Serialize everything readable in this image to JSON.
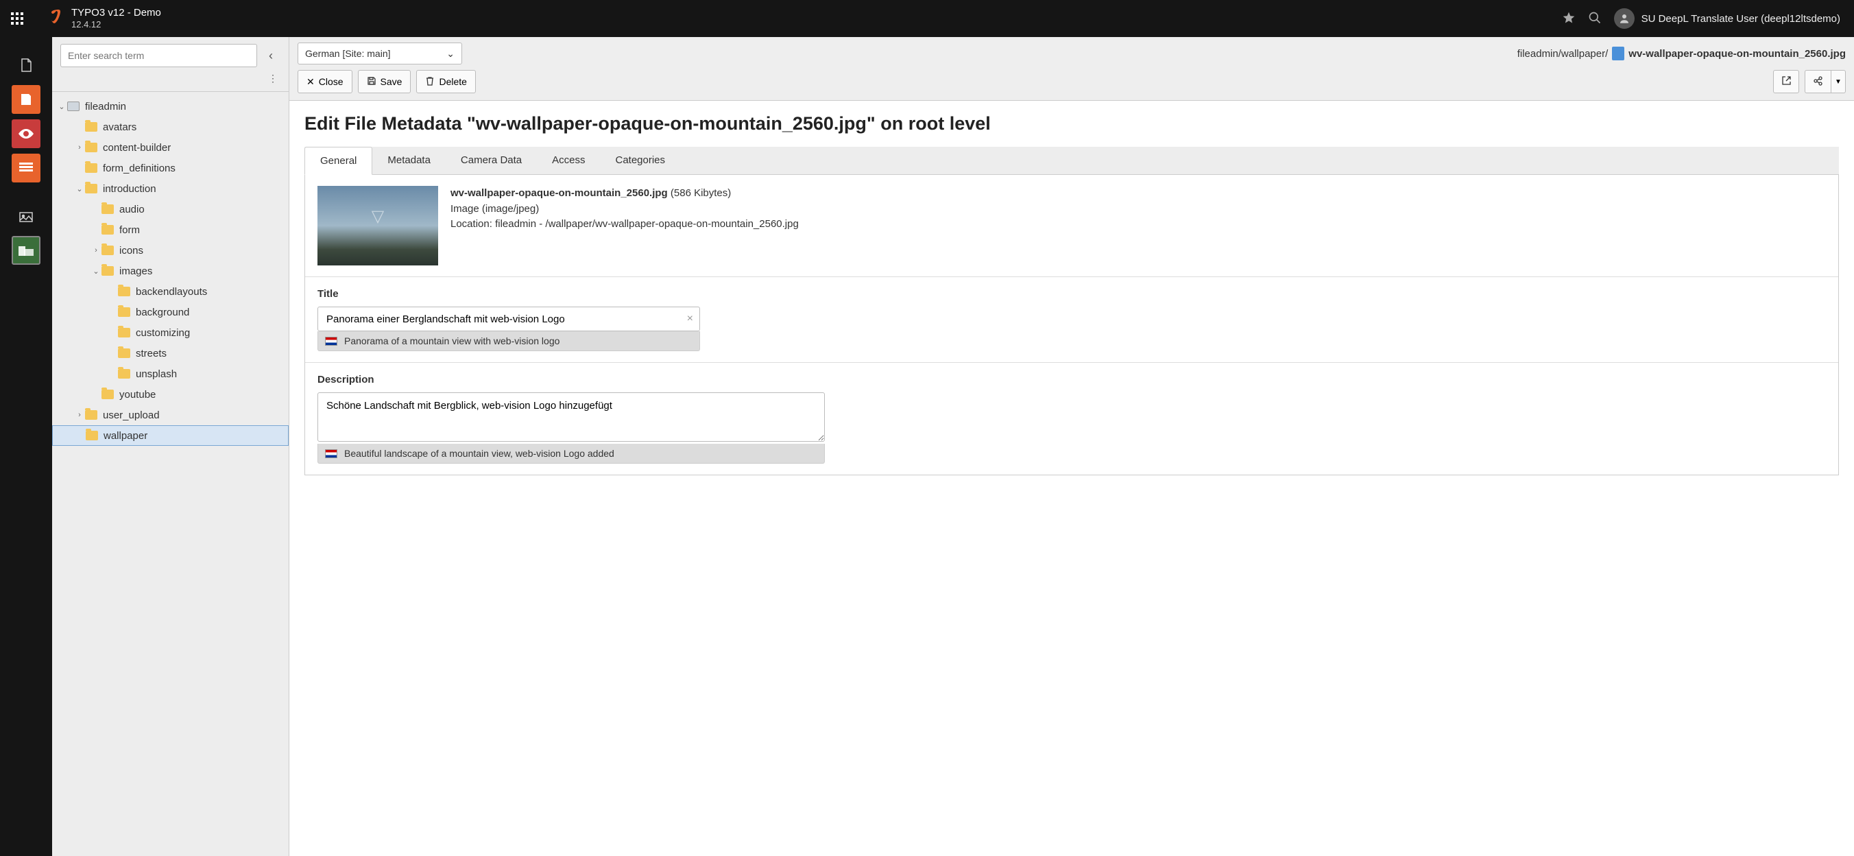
{
  "topbar": {
    "title": "TYPO3 v12 - Demo",
    "version": "12.4.12",
    "user": "SU DeepL Translate User (deepl12ltsdemo)"
  },
  "tree": {
    "search_placeholder": "Enter search term",
    "root": "fileadmin",
    "items": [
      {
        "label": "avatars",
        "depth": 1,
        "toggle": ""
      },
      {
        "label": "content-builder",
        "depth": 1,
        "toggle": ">"
      },
      {
        "label": "form_definitions",
        "depth": 1,
        "toggle": ""
      },
      {
        "label": "introduction",
        "depth": 1,
        "toggle": "v"
      },
      {
        "label": "audio",
        "depth": 2,
        "toggle": ""
      },
      {
        "label": "form",
        "depth": 2,
        "toggle": ""
      },
      {
        "label": "icons",
        "depth": 2,
        "toggle": ">"
      },
      {
        "label": "images",
        "depth": 2,
        "toggle": "v"
      },
      {
        "label": "backendlayouts",
        "depth": 3,
        "toggle": ""
      },
      {
        "label": "background",
        "depth": 3,
        "toggle": ""
      },
      {
        "label": "customizing",
        "depth": 3,
        "toggle": ""
      },
      {
        "label": "streets",
        "depth": 3,
        "toggle": ""
      },
      {
        "label": "unsplash",
        "depth": 3,
        "toggle": ""
      },
      {
        "label": "youtube",
        "depth": 2,
        "toggle": ""
      },
      {
        "label": "user_upload",
        "depth": 1,
        "toggle": ">"
      },
      {
        "label": "wallpaper",
        "depth": 1,
        "toggle": "",
        "active": true
      }
    ]
  },
  "docheader": {
    "language": "German [Site: main]",
    "path": "fileadmin/wallpaper/",
    "filename": "wv-wallpaper-opaque-on-mountain_2560.jpg",
    "close": "Close",
    "save": "Save",
    "delete": "Delete"
  },
  "page": {
    "title": "Edit File Metadata \"wv-wallpaper-opaque-on-mountain_2560.jpg\" on root level",
    "tabs": [
      "General",
      "Metadata",
      "Camera Data",
      "Access",
      "Categories"
    ],
    "active_tab": 0
  },
  "file": {
    "name": "wv-wallpaper-opaque-on-mountain_2560.jpg",
    "size": "(586 Kibytes)",
    "type": "Image (image/jpeg)",
    "location_label": "Location:",
    "location": "fileadmin - /wallpaper/wv-wallpaper-opaque-on-mountain_2560.jpg"
  },
  "fields": {
    "title_label": "Title",
    "title_value": "Panorama einer Berglandschaft mit web-vision Logo",
    "title_source": "Panorama of a mountain view with web-vision logo",
    "desc_label": "Description",
    "desc_value": "Schöne Landschaft mit Bergblick, web-vision Logo hinzugefügt",
    "desc_source": "Beautiful landscape of a mountain view, web-vision Logo added"
  }
}
